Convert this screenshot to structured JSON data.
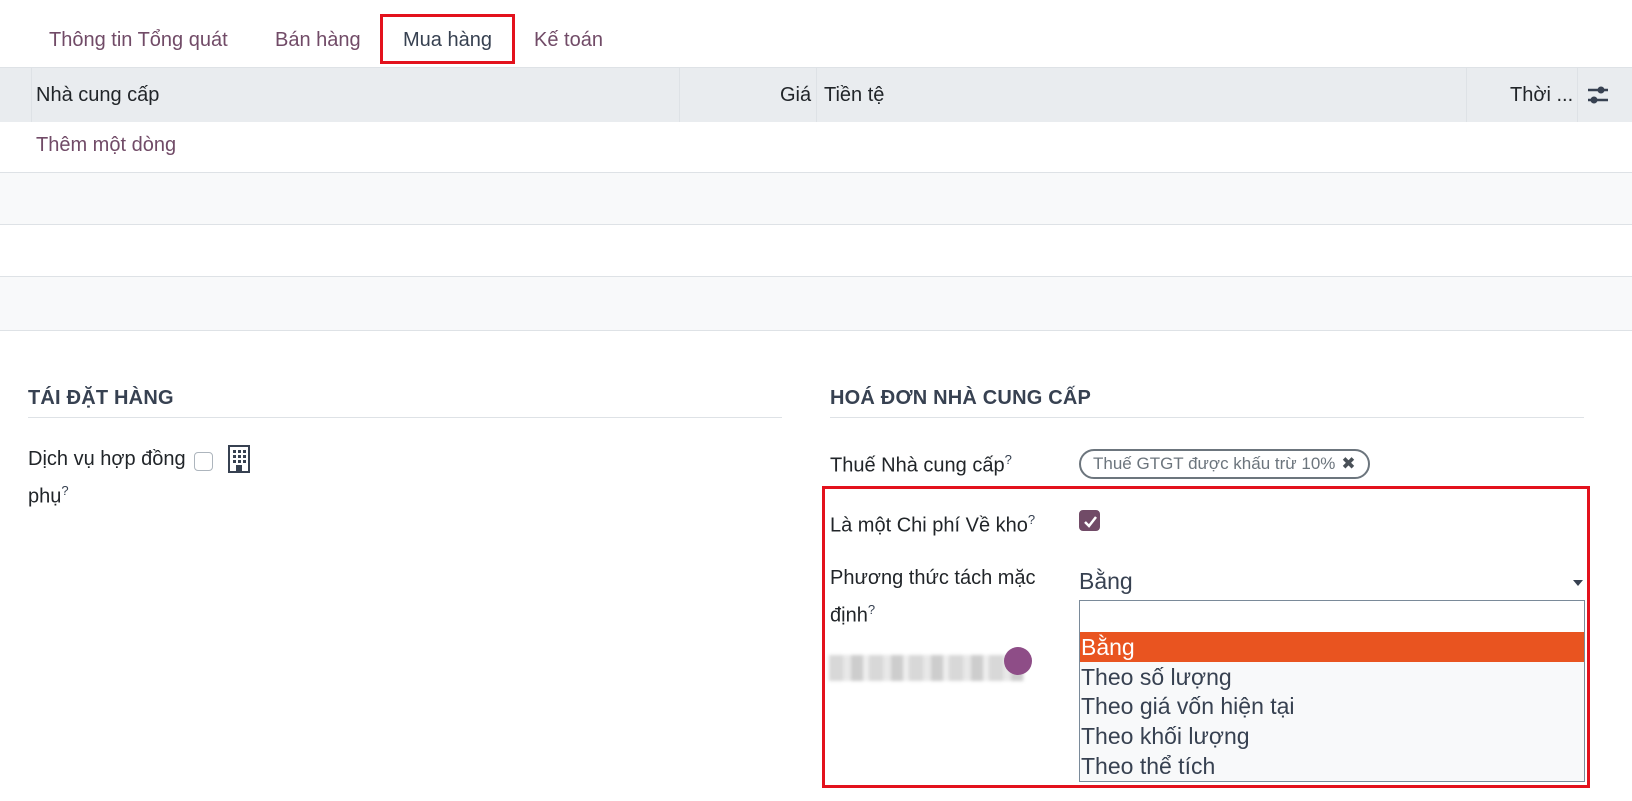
{
  "tabs": [
    {
      "label": "Thông tin Tổng quát"
    },
    {
      "label": "Bán hàng"
    },
    {
      "label": "Mua hàng",
      "active": true
    },
    {
      "label": "Kế toán"
    }
  ],
  "vendor_table": {
    "columns": [
      "Nhà cung cấp",
      "Giá",
      "Tiền tệ",
      "Thời ..."
    ],
    "add_line": "Thêm một dòng",
    "settings_icon": "sliders-icon"
  },
  "reordering": {
    "title": "TÁI ĐẶT HÀNG",
    "subcontract_label": "Dịch vụ hợp đồng phụ",
    "help": "?",
    "subcontract_checked": false,
    "building_icon": "building-icon"
  },
  "vendor_bills": {
    "title": "HOÁ ĐƠN NHÀ CUNG CẤP",
    "tax_label": "Thuế Nhà cung cấp",
    "tax_tag": "Thuế GTGT được khấu trừ 10%",
    "landed_cost_label": "Là một Chi phí Về kho",
    "landed_cost_checked": true,
    "split_method_label": "Phương thức tách mặc định",
    "split_method_value": "Bằng",
    "options": [
      "Bằng",
      "Theo số lượng",
      "Theo giá vốn hiện tại",
      "Theo khối lượng",
      "Theo thể tích"
    ],
    "help": "?"
  },
  "colors": {
    "accent": "#714b67",
    "highlight_border": "#e3121d",
    "selected_option": "#e95420"
  }
}
